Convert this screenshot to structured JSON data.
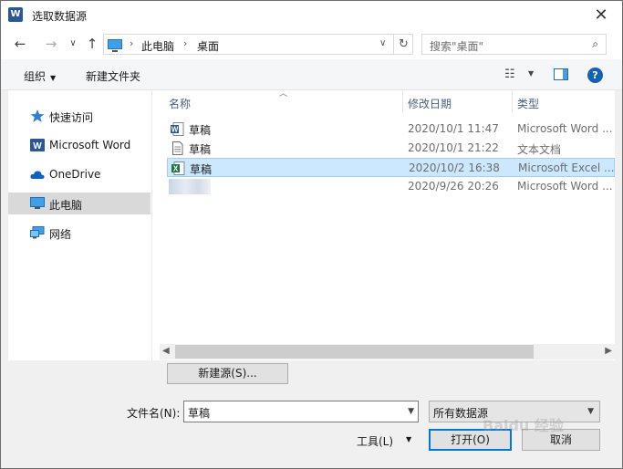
{
  "window": {
    "title": "选取数据源",
    "close": "✕"
  },
  "nav": {
    "back": "←",
    "forward": "→",
    "dropdown": "∨",
    "up": "↑",
    "crumbs": [
      "此电脑",
      "桌面"
    ],
    "crumb_sep": "›",
    "refresh": "↻",
    "search_placeholder": "搜索\"桌面\""
  },
  "toolbar": {
    "organize": "组织",
    "new_folder": "新建文件夹",
    "help": "?"
  },
  "sidebar": {
    "items": [
      {
        "label": "快速访问",
        "icon": "star-icon"
      },
      {
        "label": "Microsoft Word",
        "icon": "word-icon"
      },
      {
        "label": "OneDrive",
        "icon": "cloud-icon"
      },
      {
        "label": "此电脑",
        "icon": "computer-icon",
        "selected": true
      },
      {
        "label": "网络",
        "icon": "network-icon"
      }
    ]
  },
  "columns": {
    "name": "名称",
    "date": "修改日期",
    "type": "类型"
  },
  "files": [
    {
      "name": "草稿",
      "date": "2020/10/1 11:47",
      "type": "Microsoft Word ...",
      "icon": "word-doc-icon"
    },
    {
      "name": "草稿",
      "date": "2020/10/1 21:22",
      "type": "文本文档",
      "icon": "text-doc-icon"
    },
    {
      "name": "草稿",
      "date": "2020/10/2 16:38",
      "type": "Microsoft Excel ...",
      "icon": "excel-doc-icon",
      "selected": true
    },
    {
      "name": "",
      "date": "2020/9/26 20:26",
      "type": "Microsoft Word ...",
      "icon": "blurred-file"
    }
  ],
  "buttons": {
    "new_source": "新建源(S)...",
    "tools": "工具(L)",
    "open": "打开(O)",
    "cancel": "取消"
  },
  "filename": {
    "label": "文件名(N):",
    "value": "草稿"
  },
  "filter": {
    "value": "所有数据源"
  },
  "watermark": "Baidu 经验",
  "colors": {
    "accent": "#0078d7",
    "selection": "#cce8ff",
    "word": "#2b579a",
    "excel": "#217346"
  }
}
